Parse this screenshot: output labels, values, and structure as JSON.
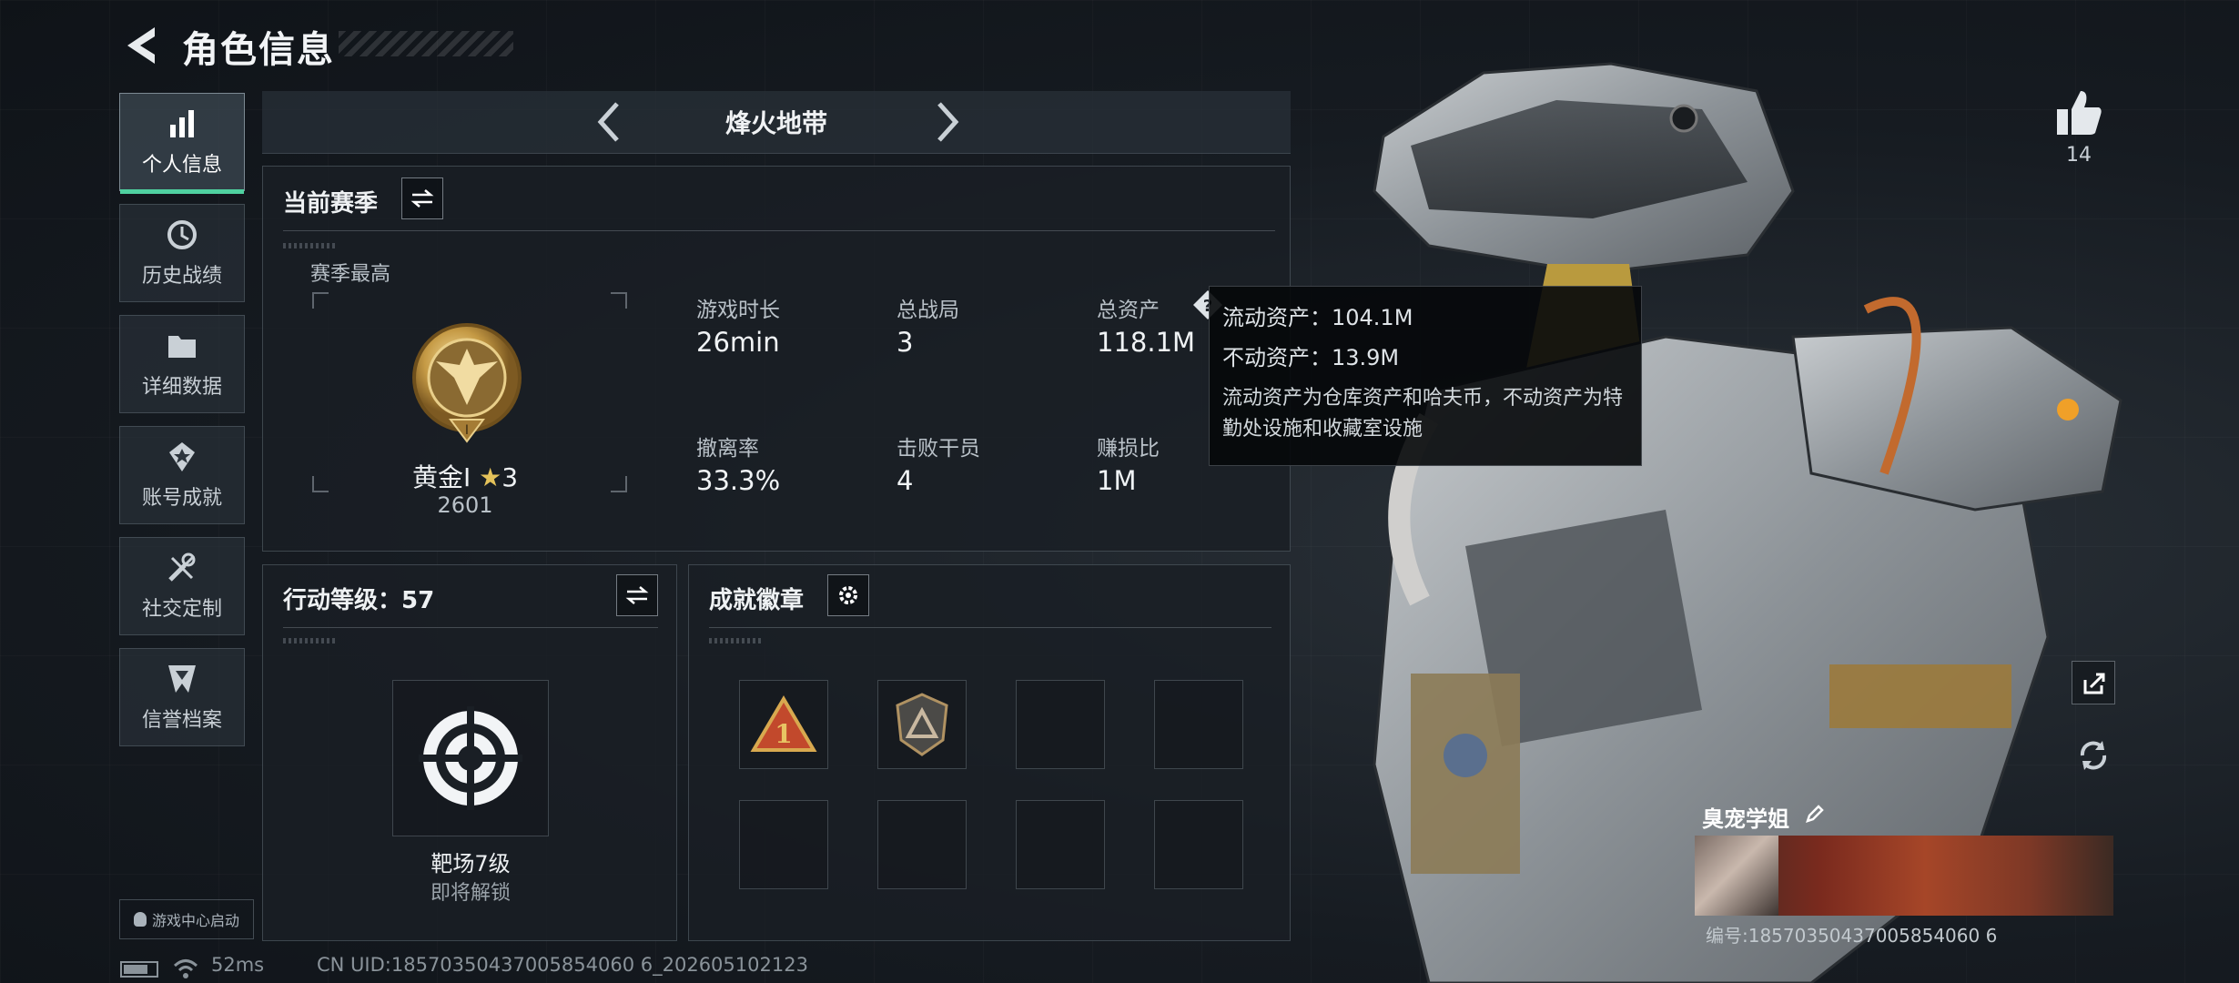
{
  "header": {
    "title": "角色信息"
  },
  "nav": [
    {
      "label": "个人信息",
      "icon": "bar-chart-icon",
      "active": true
    },
    {
      "label": "历史战绩",
      "icon": "history-clock-icon",
      "active": false
    },
    {
      "label": "详细数据",
      "icon": "folder-icon",
      "active": false
    },
    {
      "label": "账号成就",
      "icon": "medal-icon",
      "active": false
    },
    {
      "label": "社交定制",
      "icon": "tools-icon",
      "active": false
    },
    {
      "label": "信誉档案",
      "icon": "shield-badge-icon",
      "active": false
    }
  ],
  "game_center": "游戏中心启动",
  "mode": {
    "title": "烽火地带"
  },
  "season": {
    "title": "当前赛季",
    "best_label": "赛季最高",
    "rank_name": "黄金I",
    "rank_stars": "3",
    "rank_score": "2601",
    "stats": [
      {
        "label": "游戏时长",
        "value": "26min"
      },
      {
        "label": "总战局",
        "value": "3"
      },
      {
        "label": "总资产",
        "value": "118.1M"
      },
      {
        "label": "撤离率",
        "value": "33.3%"
      },
      {
        "label": "击败干员",
        "value": "4"
      },
      {
        "label": "赚损比",
        "value": "1M"
      }
    ]
  },
  "tooltip": {
    "liquid": "流动资产：104.1M",
    "fixed": "不动资产：13.9M",
    "description": "流动资产为仓库资产和哈夫币，不动资产为特勤处设施和收藏室设施"
  },
  "action_level": {
    "title": "行动等级：57",
    "item_name": "靶场7级",
    "item_status": "即将解锁"
  },
  "achievements": {
    "title": "成就徽章"
  },
  "status_bar": {
    "ping": "52ms",
    "uid": "CN UID:18570350437005854060 6_202605102123"
  },
  "likes": {
    "count": "14"
  },
  "player": {
    "name": "臭宠学姐",
    "id": "编号:18570350437005854060 6"
  },
  "colors": {
    "accent": "#4fd1a0",
    "gold": "#d2a64a",
    "tooltip_bg": "#06080a"
  }
}
